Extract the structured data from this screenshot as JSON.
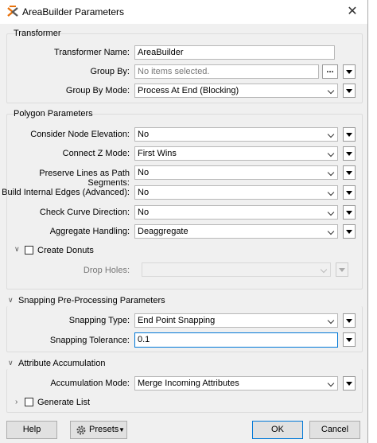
{
  "window": {
    "title": "AreaBuilder Parameters"
  },
  "transformer_group": {
    "title": "Transformer",
    "name_label": "Transformer Name:",
    "name_value": "AreaBuilder",
    "group_by_label": "Group By:",
    "group_by_placeholder": "No items selected.",
    "group_by_dots": "...",
    "group_by_mode_label": "Group By Mode:",
    "group_by_mode_value": "Process At End (Blocking)"
  },
  "polygon_group": {
    "title": "Polygon Parameters",
    "node_elev_label": "Consider Node Elevation:",
    "node_elev_value": "No",
    "connect_z_label": "Connect Z Mode:",
    "connect_z_value": "First Wins",
    "preserve_lines_label": "Preserve Lines as Path Segments:",
    "preserve_lines_value": "No",
    "internal_edges_label": "Build Internal Edges (Advanced):",
    "internal_edges_value": "No",
    "curve_dir_label": "Check Curve Direction:",
    "curve_dir_value": "No",
    "aggregate_label": "Aggregate Handling:",
    "aggregate_value": "Deaggregate",
    "donuts_label": "Create Donuts",
    "drop_holes_label": "Drop Holes:",
    "drop_holes_value": ""
  },
  "snapping_group": {
    "title": "Snapping Pre-Processing Parameters",
    "type_label": "Snapping Type:",
    "type_value": "End Point Snapping",
    "tolerance_label": "Snapping Tolerance:",
    "tolerance_value": "0.1"
  },
  "attribute_group": {
    "title": "Attribute Accumulation",
    "mode_label": "Accumulation Mode:",
    "mode_value": "Merge Incoming Attributes",
    "generate_list_label": "Generate List"
  },
  "footer": {
    "help_label": "Help",
    "presets_label": "Presets",
    "ok_label": "OK",
    "cancel_label": "Cancel"
  },
  "icons": {
    "title": "fme-transformer-icon",
    "close": "close-icon",
    "gear": "gear-icon"
  }
}
